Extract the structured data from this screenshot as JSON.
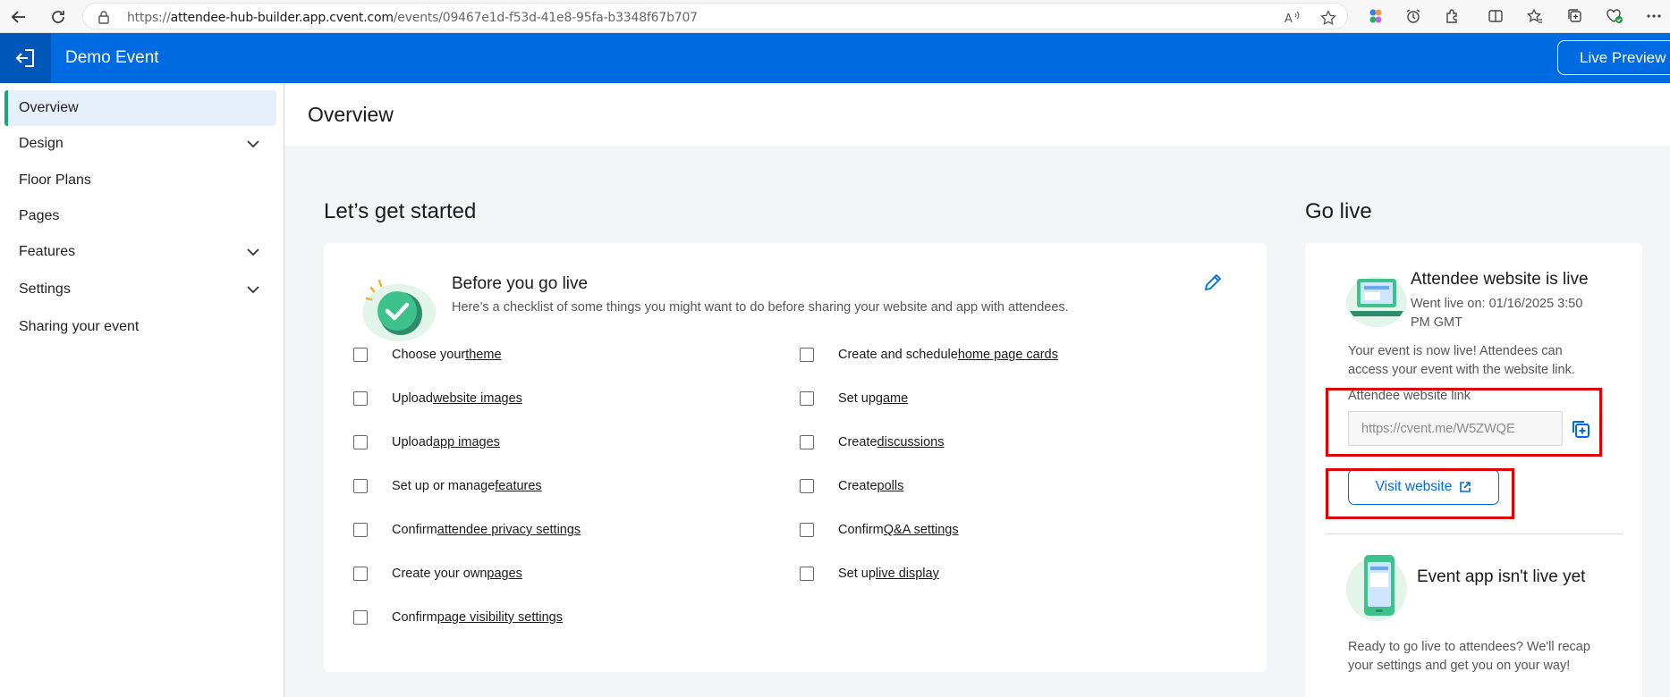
{
  "browser": {
    "url_prefix": "https://",
    "url_host": "attendee-hub-builder.app.cvent.com",
    "url_path": "/events/09467e1d-f53d-41e8-95fa-b3348f67b707"
  },
  "appbar": {
    "event_title": "Demo Event",
    "live_preview_label": "Live Preview"
  },
  "sidebar": {
    "items": [
      {
        "label": "Overview"
      },
      {
        "label": "Design"
      },
      {
        "label": "Floor Plans"
      },
      {
        "label": "Pages"
      },
      {
        "label": "Features"
      },
      {
        "label": "Settings"
      },
      {
        "label": "Sharing your event"
      }
    ]
  },
  "main": {
    "page_title": "Overview",
    "get_started_title": "Let’s get started",
    "go_live_title": "Go live",
    "checklist": {
      "title": "Before you go live",
      "description": "Here’s a checklist of some things you might want to do before sharing your website and app with attendees.",
      "left": [
        {
          "prefix": "Choose your ",
          "link": "theme"
        },
        {
          "prefix": "Upload ",
          "link": "website images"
        },
        {
          "prefix": "Upload ",
          "link": "app images"
        },
        {
          "prefix": "Set up or manage ",
          "link": "features"
        },
        {
          "prefix": "Confirm ",
          "link": "attendee privacy settings"
        },
        {
          "prefix": "Create your own ",
          "link": "pages"
        },
        {
          "prefix": "Confirm ",
          "link": "page visibility settings"
        }
      ],
      "right": [
        {
          "prefix": "Create and schedule ",
          "link": "home page cards"
        },
        {
          "prefix": "Set up ",
          "link": "game"
        },
        {
          "prefix": "Create ",
          "link": "discussions"
        },
        {
          "prefix": "Create ",
          "link": "polls"
        },
        {
          "prefix": "Confirm ",
          "link": "Q&A settings"
        },
        {
          "prefix": "Set up ",
          "link": "live display"
        }
      ]
    },
    "go_live": {
      "website_status": "Attendee website is live",
      "went_live": "Went live on: 01/16/2025 3:50 PM GMT",
      "website_message": "Your event is now live! Attendees can access your event with the website link.",
      "link_label": "Attendee website link",
      "link_value": "https://cvent.me/W5ZWQE",
      "visit_label": "Visit website",
      "app_status": "Event app isn't live yet",
      "app_message": "Ready to go live to attendees? We'll recap your settings and get you on your way!"
    }
  },
  "colors": {
    "brand_blue": "#006ae1",
    "active_accent": "#1fa37a",
    "highlight_red": "#e00000"
  }
}
